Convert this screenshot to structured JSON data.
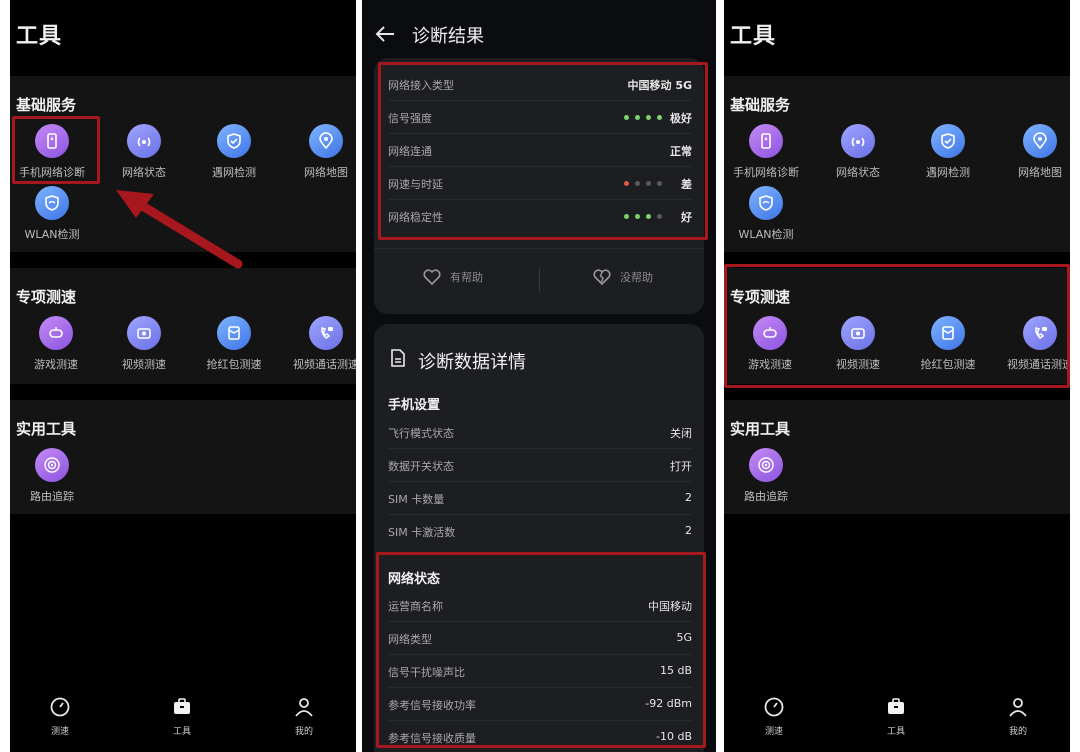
{
  "panel1": {
    "title": "工具",
    "sections": [
      {
        "title": "基础服务",
        "items": [
          {
            "label": "手机网络诊断",
            "icon": "phone-diagnose-icon"
          },
          {
            "label": "网络状态",
            "icon": "signal-status-icon"
          },
          {
            "label": "遇网检测",
            "icon": "shield-check-icon"
          },
          {
            "label": "网络地图",
            "icon": "map-pin-icon"
          },
          {
            "label": "WLAN检测",
            "icon": "wifi-shield-icon"
          }
        ]
      },
      {
        "title": "专项测速",
        "items": [
          {
            "label": "游戏测速",
            "icon": "gamepad-icon"
          },
          {
            "label": "视频测速",
            "icon": "video-icon"
          },
          {
            "label": "抢红包测速",
            "icon": "red-envelope-icon"
          },
          {
            "label": "视频通话测速",
            "icon": "video-call-icon"
          }
        ]
      },
      {
        "title": "实用工具",
        "items": [
          {
            "label": "路由追踪",
            "icon": "route-trace-icon"
          }
        ]
      }
    ],
    "nav": [
      {
        "label": "测速",
        "icon": "speedometer-icon"
      },
      {
        "label": "工具",
        "icon": "toolbox-icon"
      },
      {
        "label": "我的",
        "icon": "person-icon"
      }
    ]
  },
  "panel2": {
    "title": "诊断结果",
    "result_rows": [
      {
        "key": "网络接入类型",
        "value": "中国移动 5G"
      },
      {
        "key": "信号强度",
        "value": "极好",
        "dots": [
          "green",
          "green",
          "green",
          "green"
        ]
      },
      {
        "key": "网络连通",
        "value": "正常"
      },
      {
        "key": "网速与时延",
        "value": "差",
        "dots": [
          "red",
          "gray",
          "gray",
          "gray"
        ]
      },
      {
        "key": "网络稳定性",
        "value": "好",
        "dots": [
          "green",
          "green",
          "green",
          "gray"
        ]
      }
    ],
    "helpful": "有帮助",
    "not_helpful": "没帮助",
    "details_title": "诊断数据详情",
    "phone_settings_title": "手机设置",
    "phone_settings": [
      {
        "key": "飞行模式状态",
        "value": "关闭"
      },
      {
        "key": "数据开关状态",
        "value": "打开"
      },
      {
        "key": "SIM 卡数量",
        "value": "2"
      },
      {
        "key": "SIM 卡激活数",
        "value": "2"
      }
    ],
    "network_status_title": "网络状态",
    "network_status": [
      {
        "key": "运营商名称",
        "value": "中国移动"
      },
      {
        "key": "网络类型",
        "value": "5G"
      },
      {
        "key": "信号干扰噪声比",
        "value": "15 dB"
      },
      {
        "key": "参考信号接收功率",
        "value": "-92 dBm"
      },
      {
        "key": "参考信号接收质量",
        "value": "-10 dB"
      }
    ]
  },
  "colors": {
    "green": "#7dd36a",
    "red": "#e0584f",
    "gray": "#5a5a5a",
    "highlight": "#a6181d"
  }
}
